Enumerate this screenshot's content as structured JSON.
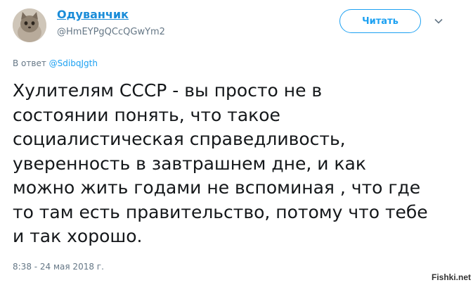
{
  "author": {
    "display_name": "Одуванчик",
    "handle": "@HmEYPgQCcQGwYm2"
  },
  "follow_button": {
    "label": "Читать"
  },
  "reply": {
    "prefix": "В ответ",
    "mention": "@SdibqJgth"
  },
  "tweet": {
    "lines": [
      "Хулителям СССР - вы просто не в",
      "состоянии понять, что такое",
      "социалистическая справедливость,",
      "уверенность в завтрашнем дне, и как",
      "можно жить годами не вспоминая , что где",
      "то там есть правительство, потому что тебе",
      "и так хорошо."
    ]
  },
  "timestamp": "8:38 - 24 мая 2018 г.",
  "watermark": "Fishki.net",
  "colors": {
    "link": "#1da1f2",
    "text": "#14171a",
    "muted": "#657786"
  }
}
